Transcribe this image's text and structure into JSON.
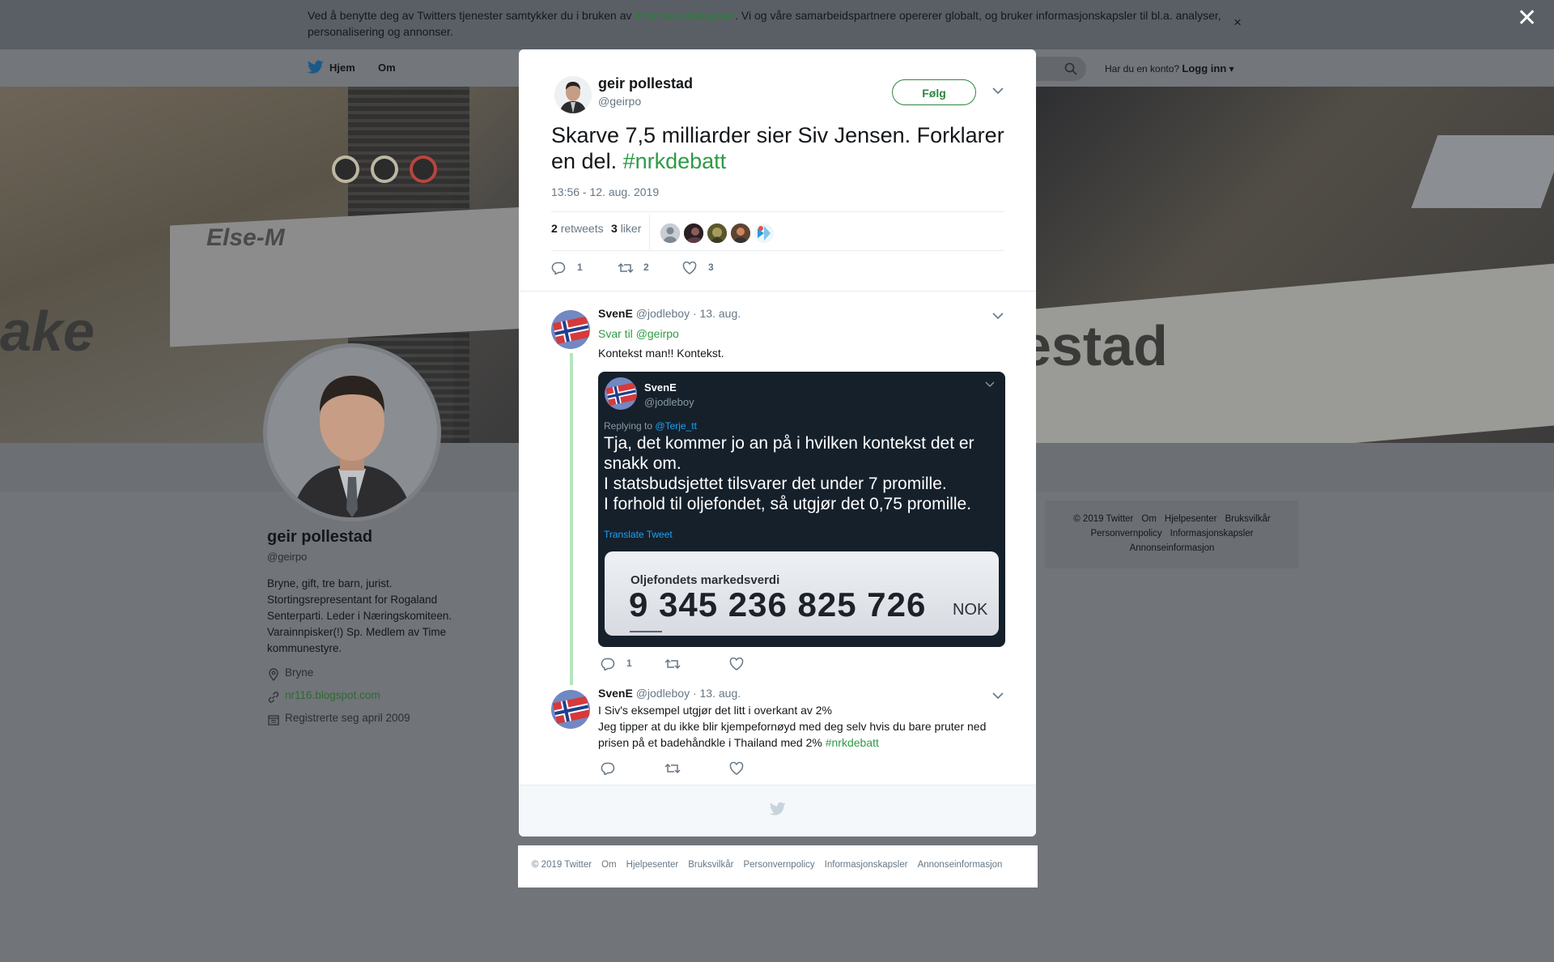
{
  "cookie": {
    "text_before": "Ved å benytte deg av Twitters tjenester samtykker du i bruken av ",
    "link": "informasjonskapsler",
    "text_after": ". Vi og våre samarbeidspartnere opererer globalt, og bruker informasjonskapsler til bl.a. analyser, personalisering og annonser.",
    "close": "×"
  },
  "page_close": "✕",
  "nav": {
    "home": "Hjem",
    "about": "Om",
    "account_prompt": "Har du en konto?",
    "login": "Logg inn"
  },
  "cover": {
    "left_sign": "ake",
    "left_sign_name": "Else-M",
    "right_sign": "estad"
  },
  "profile": {
    "name": "geir pollestad",
    "handle": "@geirpo",
    "bio": "Bryne, gift, tre barn, jurist. Stortingsrepresentant for Rogaland Senterparti. Leder i Næringskomiteen. Varainnpisker(!) Sp. Medlem av Time kommunestyre.",
    "location": "Bryne",
    "url": "nr116.blogspot.com",
    "joined": "Registrerte seg april 2009"
  },
  "side_footer": [
    "© 2019 Twitter",
    "Om",
    "Hjelpesenter",
    "Bruksvilkår",
    "Personvernpolicy",
    "Informasjonskapsler",
    "Annonseinformasjon"
  ],
  "tweet": {
    "author_name": "geir pollestad",
    "author_handle": "@geirpo",
    "follow": "Følg",
    "text": "Skarve 7,5 milliarder sier Siv Jensen. Forklarer en del. ",
    "hashtag": "#nrkdebatt",
    "timestamp": "13:56 - 12. aug. 2019",
    "retweets_count": "2",
    "retweets_label": "retweets",
    "likes_count": "3",
    "likes_label": "liker",
    "replies_action": "1",
    "retweets_action": "2",
    "likes_action": "3"
  },
  "replies": [
    {
      "name": "SvenE",
      "handle": "@jodleboy",
      "date": "· 13. aug.",
      "reply_to_label": "Svar til",
      "reply_to": "@geirpo",
      "text": "Kontekst man!! Kontekst.",
      "replies_action": "1"
    },
    {
      "name": "SvenE",
      "handle": "@jodleboy",
      "date": "· 13. aug.",
      "text_line1": "I Siv's eksempel utgjør det litt i overkant av 2%",
      "text_line2": "Jeg tipper at du ikke blir kjempefornøyd med deg selv hvis du bare pruter ned prisen på et badehåndkle i Thailand med 2% ",
      "hashtag": "#nrkdebatt"
    }
  ],
  "embed": {
    "name": "SvenE",
    "handle": "@jodleboy",
    "replying_label": "Replying to",
    "replying_to": "@Terje_tt",
    "text": "Tja, det kommer jo an på i hvilken kontekst det er snakk om.\nI statsbudsjettet tilsvarer det under 7 promille.\nI forhold til oljefondet, så utgjør det 0,75 promille.",
    "translate": "Translate Tweet",
    "card_label": "Oljefondets markedsverdi",
    "card_value": "9 345 236 825 726",
    "card_unit": "NOK"
  },
  "bottom_footer": [
    "© 2019 Twitter",
    "Om",
    "Hjelpesenter",
    "Bruksvilkår",
    "Personvernpolicy",
    "Informasjonskapsler",
    "Annonseinformasjon"
  ],
  "colors": {
    "accent_green": "#2e9b45",
    "link_blue": "#1da1f2",
    "overlay": "#717479"
  }
}
